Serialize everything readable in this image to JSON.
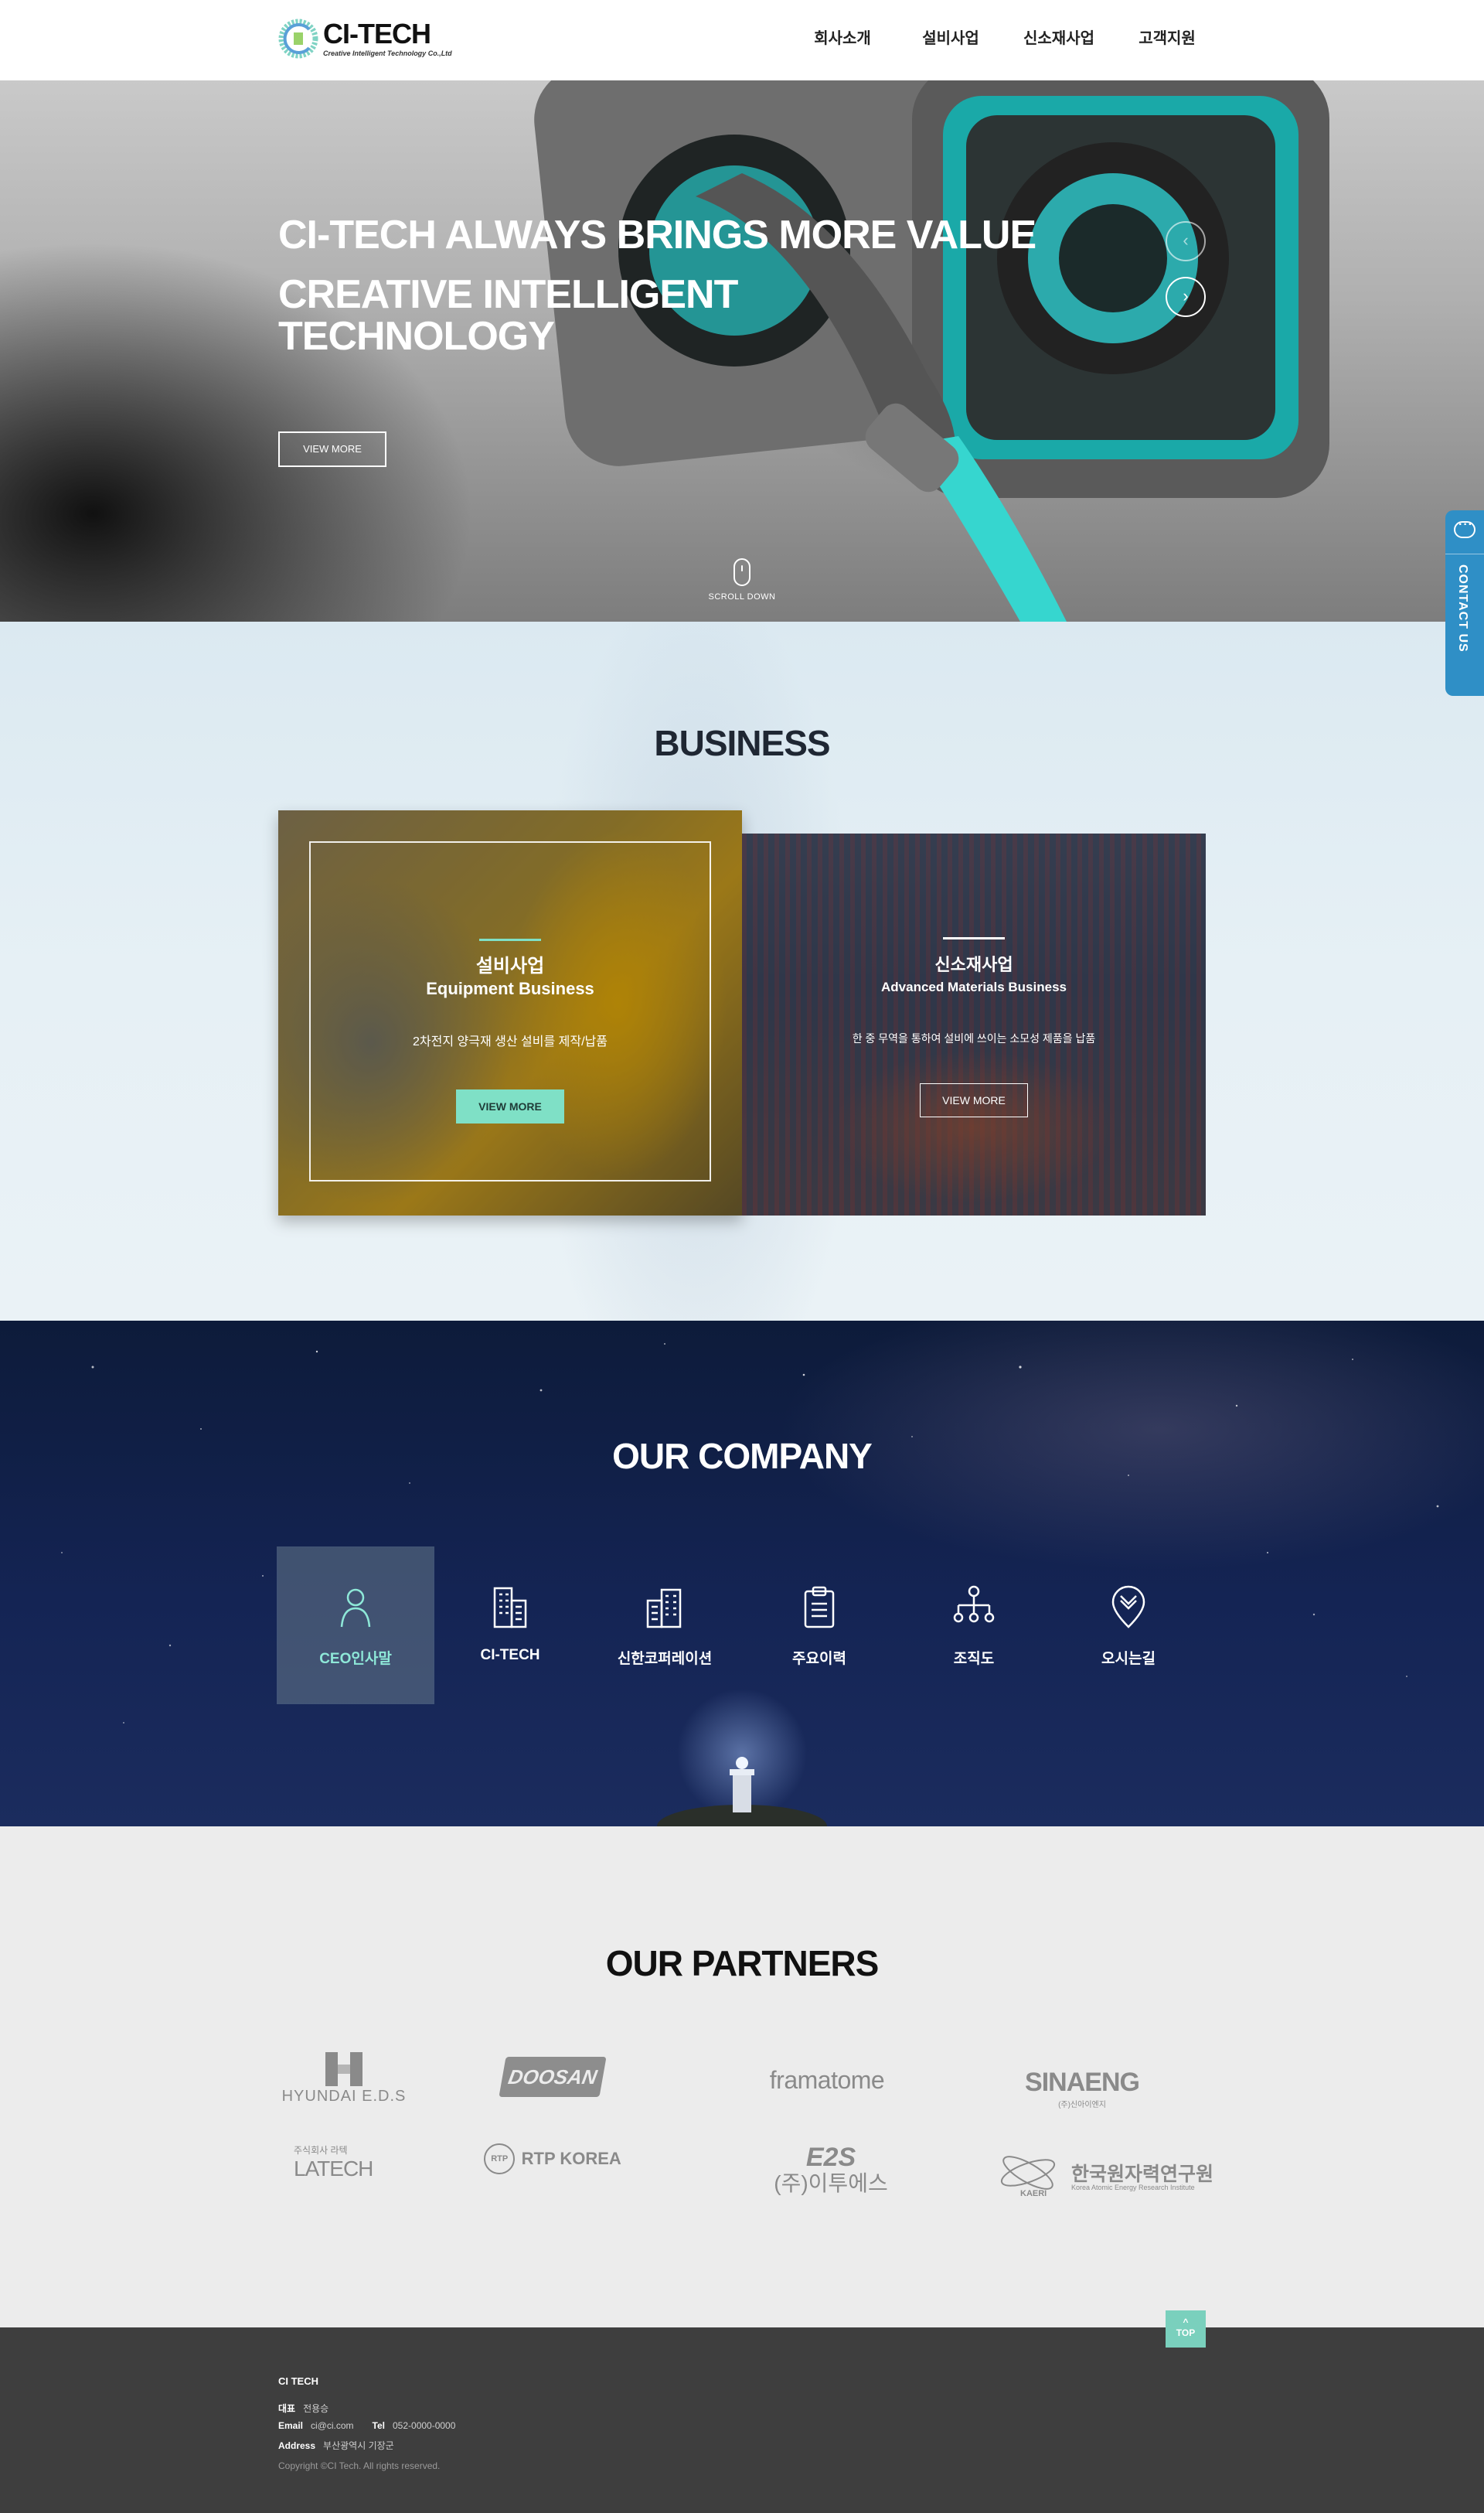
{
  "header": {
    "brand": "CI-TECH",
    "tagline": "Creative Intelligent Technology Co.,Ltd",
    "nav": [
      "회사소개",
      "설비사업",
      "신소재사업",
      "고객지원"
    ]
  },
  "hero": {
    "title": "CI-TECH ALWAYS BRINGS MORE VALUE",
    "subtitle": "CREATIVE INTELLIGENT\nTECHNOLOGY",
    "button": "VIEW MORE",
    "prev_symbol": "‹",
    "next_symbol": "›",
    "scroll_label": "SCROLL DOWN"
  },
  "contact_tab": {
    "label": "CONTACT US"
  },
  "business": {
    "title": "BUSINESS",
    "cards": [
      {
        "title_ko": "설비사업",
        "title_en": "Equipment Business",
        "description": "2차전지 양극재 생산 설비를 제작/납품",
        "button": "VIEW MORE"
      },
      {
        "title_ko": "신소재사업",
        "title_en": "Advanced Materials Business",
        "description": "한 중 무역을 통하여 설비에 쓰이는 소모성 제품을 납품",
        "button": "VIEW MORE"
      }
    ]
  },
  "company": {
    "title": "OUR COMPANY",
    "items": [
      {
        "label": "CEO인사말",
        "icon": "person-icon",
        "active": true
      },
      {
        "label": "CI-TECH",
        "icon": "building-icon",
        "active": false
      },
      {
        "label": "신한코퍼레이션",
        "icon": "office-building-icon",
        "active": false
      },
      {
        "label": "주요이력",
        "icon": "clipboard-icon",
        "active": false
      },
      {
        "label": "조직도",
        "icon": "org-chart-icon",
        "active": false
      },
      {
        "label": "오시는길",
        "icon": "location-pin-icon",
        "active": false
      }
    ]
  },
  "partners": {
    "title": "OUR PARTNERS",
    "logos": {
      "hyundai": {
        "mark": "H",
        "name": "HYUNDAI E.D.S"
      },
      "doosan": {
        "name": "DOOSAN"
      },
      "framatome": {
        "name": "framatome"
      },
      "sinaeng": {
        "name": "SINAENG",
        "sub": "(주)신아이엔지"
      },
      "latech": {
        "small": "주식회사 라텍",
        "name": "LATECH"
      },
      "rtp": {
        "mark": "RTP",
        "name": "RTP KOREA"
      },
      "e2s": {
        "mark": "E2S",
        "name": "(주)이투에스"
      },
      "kaeri": {
        "mark": "KAERI",
        "name": "한국원자력연구원",
        "sub": "Korea Atomic Energy Research Institute"
      }
    }
  },
  "footer": {
    "company": "CI TECH",
    "ceo_label": "대표",
    "ceo": "전용승",
    "email_label": "Email",
    "email": "ci@ci.com",
    "tel_label": "Tel",
    "tel": "052-0000-0000",
    "address_label": "Address",
    "address": "부산광역시 기장군",
    "copyright": "Copyright ©CI Tech. All rights reserved."
  },
  "top_button": {
    "label": "TOP",
    "symbol": "^"
  },
  "colors": {
    "accent_mint": "#7fe0c6",
    "contact_blue": "#2f8fc6",
    "footer_bg": "#3e3e3e",
    "company_bg": "#142454"
  }
}
